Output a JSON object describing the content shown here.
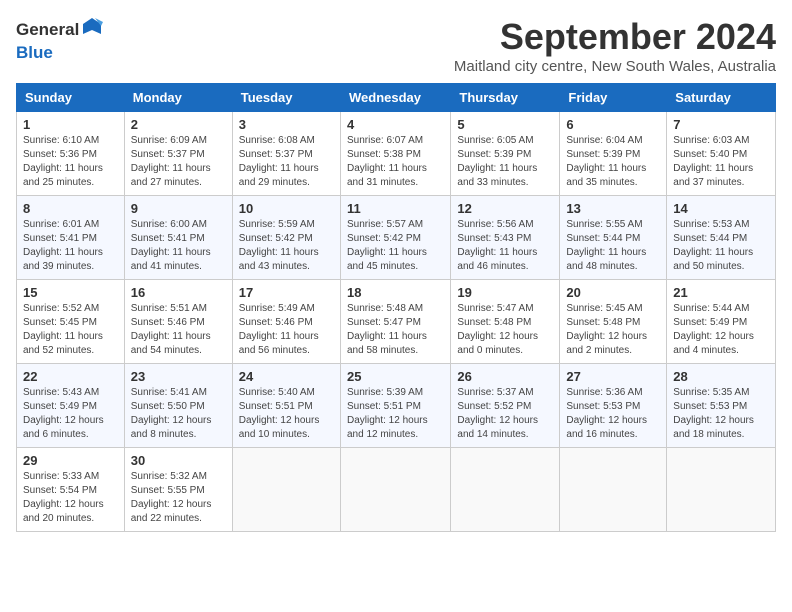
{
  "header": {
    "logo_general": "General",
    "logo_blue": "Blue",
    "month_title": "September 2024",
    "subtitle": "Maitland city centre, New South Wales, Australia"
  },
  "days_of_week": [
    "Sunday",
    "Monday",
    "Tuesday",
    "Wednesday",
    "Thursday",
    "Friday",
    "Saturday"
  ],
  "weeks": [
    [
      {
        "day": "1",
        "sunrise": "Sunrise: 6:10 AM",
        "sunset": "Sunset: 5:36 PM",
        "daylight": "Daylight: 11 hours and 25 minutes."
      },
      {
        "day": "2",
        "sunrise": "Sunrise: 6:09 AM",
        "sunset": "Sunset: 5:37 PM",
        "daylight": "Daylight: 11 hours and 27 minutes."
      },
      {
        "day": "3",
        "sunrise": "Sunrise: 6:08 AM",
        "sunset": "Sunset: 5:37 PM",
        "daylight": "Daylight: 11 hours and 29 minutes."
      },
      {
        "day": "4",
        "sunrise": "Sunrise: 6:07 AM",
        "sunset": "Sunset: 5:38 PM",
        "daylight": "Daylight: 11 hours and 31 minutes."
      },
      {
        "day": "5",
        "sunrise": "Sunrise: 6:05 AM",
        "sunset": "Sunset: 5:39 PM",
        "daylight": "Daylight: 11 hours and 33 minutes."
      },
      {
        "day": "6",
        "sunrise": "Sunrise: 6:04 AM",
        "sunset": "Sunset: 5:39 PM",
        "daylight": "Daylight: 11 hours and 35 minutes."
      },
      {
        "day": "7",
        "sunrise": "Sunrise: 6:03 AM",
        "sunset": "Sunset: 5:40 PM",
        "daylight": "Daylight: 11 hours and 37 minutes."
      }
    ],
    [
      {
        "day": "8",
        "sunrise": "Sunrise: 6:01 AM",
        "sunset": "Sunset: 5:41 PM",
        "daylight": "Daylight: 11 hours and 39 minutes."
      },
      {
        "day": "9",
        "sunrise": "Sunrise: 6:00 AM",
        "sunset": "Sunset: 5:41 PM",
        "daylight": "Daylight: 11 hours and 41 minutes."
      },
      {
        "day": "10",
        "sunrise": "Sunrise: 5:59 AM",
        "sunset": "Sunset: 5:42 PM",
        "daylight": "Daylight: 11 hours and 43 minutes."
      },
      {
        "day": "11",
        "sunrise": "Sunrise: 5:57 AM",
        "sunset": "Sunset: 5:42 PM",
        "daylight": "Daylight: 11 hours and 45 minutes."
      },
      {
        "day": "12",
        "sunrise": "Sunrise: 5:56 AM",
        "sunset": "Sunset: 5:43 PM",
        "daylight": "Daylight: 11 hours and 46 minutes."
      },
      {
        "day": "13",
        "sunrise": "Sunrise: 5:55 AM",
        "sunset": "Sunset: 5:44 PM",
        "daylight": "Daylight: 11 hours and 48 minutes."
      },
      {
        "day": "14",
        "sunrise": "Sunrise: 5:53 AM",
        "sunset": "Sunset: 5:44 PM",
        "daylight": "Daylight: 11 hours and 50 minutes."
      }
    ],
    [
      {
        "day": "15",
        "sunrise": "Sunrise: 5:52 AM",
        "sunset": "Sunset: 5:45 PM",
        "daylight": "Daylight: 11 hours and 52 minutes."
      },
      {
        "day": "16",
        "sunrise": "Sunrise: 5:51 AM",
        "sunset": "Sunset: 5:46 PM",
        "daylight": "Daylight: 11 hours and 54 minutes."
      },
      {
        "day": "17",
        "sunrise": "Sunrise: 5:49 AM",
        "sunset": "Sunset: 5:46 PM",
        "daylight": "Daylight: 11 hours and 56 minutes."
      },
      {
        "day": "18",
        "sunrise": "Sunrise: 5:48 AM",
        "sunset": "Sunset: 5:47 PM",
        "daylight": "Daylight: 11 hours and 58 minutes."
      },
      {
        "day": "19",
        "sunrise": "Sunrise: 5:47 AM",
        "sunset": "Sunset: 5:48 PM",
        "daylight": "Daylight: 12 hours and 0 minutes."
      },
      {
        "day": "20",
        "sunrise": "Sunrise: 5:45 AM",
        "sunset": "Sunset: 5:48 PM",
        "daylight": "Daylight: 12 hours and 2 minutes."
      },
      {
        "day": "21",
        "sunrise": "Sunrise: 5:44 AM",
        "sunset": "Sunset: 5:49 PM",
        "daylight": "Daylight: 12 hours and 4 minutes."
      }
    ],
    [
      {
        "day": "22",
        "sunrise": "Sunrise: 5:43 AM",
        "sunset": "Sunset: 5:49 PM",
        "daylight": "Daylight: 12 hours and 6 minutes."
      },
      {
        "day": "23",
        "sunrise": "Sunrise: 5:41 AM",
        "sunset": "Sunset: 5:50 PM",
        "daylight": "Daylight: 12 hours and 8 minutes."
      },
      {
        "day": "24",
        "sunrise": "Sunrise: 5:40 AM",
        "sunset": "Sunset: 5:51 PM",
        "daylight": "Daylight: 12 hours and 10 minutes."
      },
      {
        "day": "25",
        "sunrise": "Sunrise: 5:39 AM",
        "sunset": "Sunset: 5:51 PM",
        "daylight": "Daylight: 12 hours and 12 minutes."
      },
      {
        "day": "26",
        "sunrise": "Sunrise: 5:37 AM",
        "sunset": "Sunset: 5:52 PM",
        "daylight": "Daylight: 12 hours and 14 minutes."
      },
      {
        "day": "27",
        "sunrise": "Sunrise: 5:36 AM",
        "sunset": "Sunset: 5:53 PM",
        "daylight": "Daylight: 12 hours and 16 minutes."
      },
      {
        "day": "28",
        "sunrise": "Sunrise: 5:35 AM",
        "sunset": "Sunset: 5:53 PM",
        "daylight": "Daylight: 12 hours and 18 minutes."
      }
    ],
    [
      {
        "day": "29",
        "sunrise": "Sunrise: 5:33 AM",
        "sunset": "Sunset: 5:54 PM",
        "daylight": "Daylight: 12 hours and 20 minutes."
      },
      {
        "day": "30",
        "sunrise": "Sunrise: 5:32 AM",
        "sunset": "Sunset: 5:55 PM",
        "daylight": "Daylight: 12 hours and 22 minutes."
      },
      null,
      null,
      null,
      null,
      null
    ]
  ]
}
